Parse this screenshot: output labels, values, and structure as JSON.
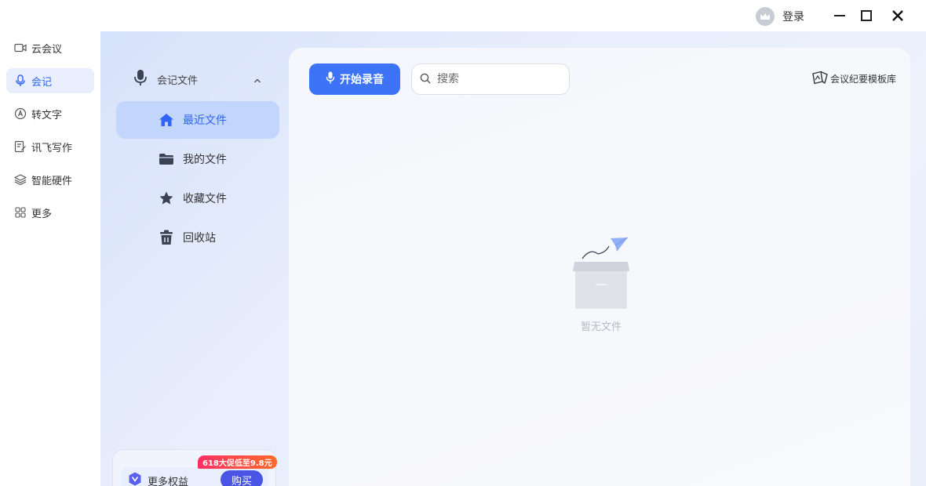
{
  "titlebar": {
    "login_label": "登录",
    "icons": [
      "avatar-icon",
      "minimize-icon",
      "maximize-icon",
      "close-icon"
    ]
  },
  "leftnav": {
    "items": [
      {
        "label": "云会议",
        "icon": "video-camera-icon",
        "active": false
      },
      {
        "label": "会记",
        "icon": "microphone-icon",
        "active": true
      },
      {
        "label": "转文字",
        "icon": "text-convert-icon",
        "active": false
      },
      {
        "label": "讯飞写作",
        "icon": "edit-document-icon",
        "active": false
      },
      {
        "label": "智能硬件",
        "icon": "layers-icon",
        "active": false
      },
      {
        "label": "更多",
        "icon": "grid-icon",
        "active": false
      }
    ]
  },
  "subnav": {
    "header": "会记文件",
    "items": [
      {
        "label": "最近文件",
        "icon": "home-icon",
        "active": true
      },
      {
        "label": "我的文件",
        "icon": "folder-icon",
        "active": false
      },
      {
        "label": "收藏文件",
        "icon": "star-icon",
        "active": false
      },
      {
        "label": "回收站",
        "icon": "trash-icon",
        "active": false
      }
    ]
  },
  "promo": {
    "badge": "618大促低至9.8元",
    "label": "更多权益",
    "buy_label": "购买"
  },
  "main": {
    "record_label": "开始录音",
    "search_placeholder": "搜索",
    "template_label": "会议纪要模板库",
    "empty_text": "暂无文件"
  },
  "colors": {
    "accent": "#3d73f7",
    "active_nav_bg": "#e8eefb",
    "active_sub_bg": "#c2d5fb",
    "promo_badge": "#ff2f64",
    "buy_button": "#4a55e6"
  }
}
